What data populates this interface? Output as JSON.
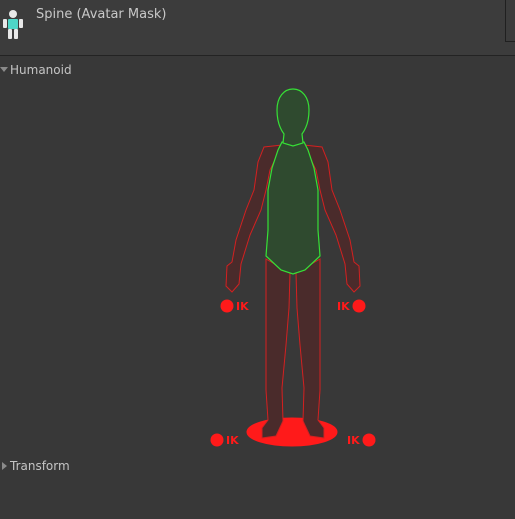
{
  "header": {
    "title": "Spine (Avatar Mask)",
    "icon": "avatar-mask-icon"
  },
  "sections": {
    "humanoid": {
      "label": "Humanoid",
      "expanded": true
    },
    "transform": {
      "label": "Transform",
      "expanded": false
    }
  },
  "avatar_mask": {
    "ik": {
      "left_hand": "IK",
      "right_hand": "IK",
      "left_foot": "IK",
      "right_foot": "IK"
    },
    "body_parts": {
      "head": "enabled",
      "body": "enabled",
      "left_arm": "disabled",
      "right_arm": "disabled",
      "left_leg": "disabled",
      "right_leg": "disabled",
      "left_hand_ik": "disabled",
      "right_hand_ik": "disabled",
      "left_foot_ik": "disabled",
      "right_foot_ik": "disabled",
      "root": "disabled"
    }
  },
  "colors": {
    "enabled_stroke": "#36e036",
    "enabled_fill": "#2f4a2f",
    "disabled_stroke": "#d42020",
    "disabled_fill": "#4a2b2b",
    "ik_red": "#ff1a1a"
  }
}
